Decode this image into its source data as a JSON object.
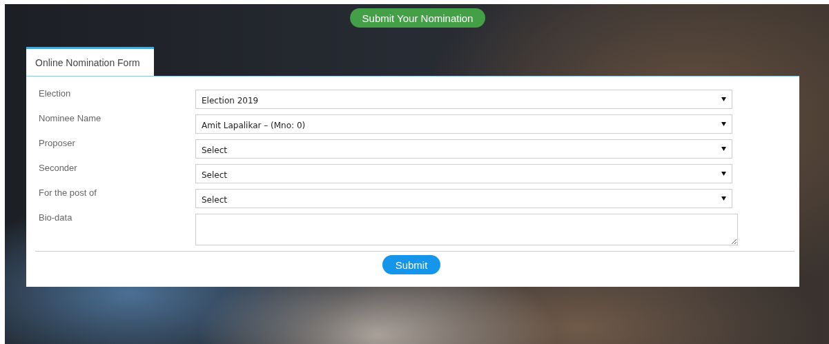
{
  "header_button": "Submit Your Nomination",
  "tabs": [
    {
      "label": "Online Nomination Form",
      "selected": true
    }
  ],
  "fields": [
    {
      "label": "Election",
      "kind": "select",
      "value": "Election 2019"
    },
    {
      "label": "Nominee Name",
      "kind": "select",
      "value": "Amit Lapalikar – (Mno: 0)"
    },
    {
      "label": "Proposer",
      "kind": "select",
      "value": "Select"
    },
    {
      "label": "Seconder",
      "kind": "select",
      "value": "Select"
    },
    {
      "label": "For the post of",
      "kind": "select",
      "value": "Select"
    },
    {
      "label": "Bio-data",
      "kind": "textarea"
    }
  ],
  "submit_button": "Submit"
}
